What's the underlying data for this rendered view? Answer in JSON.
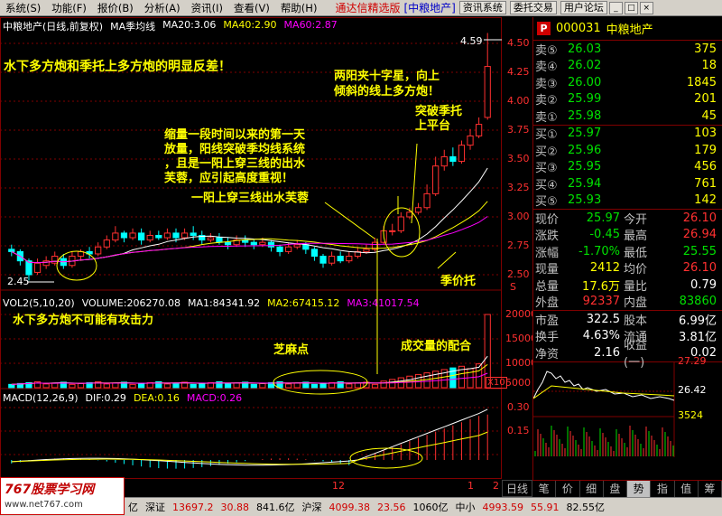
{
  "menu": {
    "items": [
      "系统(S)",
      "功能(F)",
      "报价(B)",
      "分析(A)",
      "资讯(I)",
      "查看(V)",
      "帮助(H)"
    ],
    "brand": "通达信精选版",
    "stock_tag": "[中粮地产]",
    "buttons": [
      "资讯系统",
      "委托交易",
      "用户论坛"
    ],
    "win_buttons": [
      "_",
      "□",
      "×"
    ]
  },
  "kline": {
    "title": "中粮地产(日线,前复权)",
    "indicator": "MA季均线",
    "ma20": "MA20:3.06",
    "ma40": "MA40:2.90",
    "ma60": "MA60:2.87",
    "high_label": "4.59",
    "low_label": "2.45",
    "y_ticks": [
      "4.50",
      "4.25",
      "4.00",
      "3.75",
      "3.50",
      "3.25",
      "3.00",
      "2.75",
      "2.50"
    ],
    "s_mark": "S"
  },
  "volume": {
    "title": "VOL2(5,10,20)",
    "vol": "VOLUME:206270.08",
    "ma1": "MA1:84341.92",
    "ma2": "MA2:67415.12",
    "ma3": "MA3:41017.54",
    "y_ticks": [
      "20000",
      "15000",
      "10000",
      "5000"
    ],
    "unit": "X10"
  },
  "macd": {
    "title": "MACD(12,26,9)",
    "dif": "DIF:0.29",
    "dea": "DEA:0.16",
    "macd": "MACD:0.26",
    "y_ticks": [
      "0.30",
      "0.15"
    ]
  },
  "x_labels": [
    "12",
    "1",
    "2"
  ],
  "annotations": {
    "a1": "水下多方炮和季托上多方炮的明显反差！",
    "a2_line1": "两阳夹十字星，向上",
    "a2_line2": "倾斜的线上多方炮！",
    "a3_line1": "突破季托",
    "a3_line2": "上平台",
    "a4_line1": "缩量一段时间以来的第一天",
    "a4_line2": "放量，阳线突破季均线系统",
    "a4_line3": "，且是一阳上穿三线的出水",
    "a4_line4": "芙蓉，应引起高度重视！",
    "a5": "一阳上穿三线出水芙蓉",
    "a6": "季价托",
    "a7": "水下多方炮不可能有攻击力",
    "a8": "芝麻点",
    "a9": "成交量的配合"
  },
  "quote": {
    "p": "P",
    "code": "000031",
    "name": "中粮地产",
    "sells": [
      {
        "label": "卖⑤",
        "price": "26.03",
        "vol": "375"
      },
      {
        "label": "卖④",
        "price": "26.02",
        "vol": "18"
      },
      {
        "label": "卖③",
        "price": "26.00",
        "vol": "1845"
      },
      {
        "label": "卖②",
        "price": "25.99",
        "vol": "201"
      },
      {
        "label": "卖①",
        "price": "25.98",
        "vol": "45"
      }
    ],
    "buys": [
      {
        "label": "买①",
        "price": "25.97",
        "vol": "103"
      },
      {
        "label": "买②",
        "price": "25.96",
        "vol": "179"
      },
      {
        "label": "买③",
        "price": "25.95",
        "vol": "456"
      },
      {
        "label": "买④",
        "price": "25.94",
        "vol": "761"
      },
      {
        "label": "买⑤",
        "price": "25.93",
        "vol": "142"
      }
    ],
    "stats": [
      {
        "l": "现价",
        "v": "25.97",
        "l2": "今开",
        "v2": "26.10"
      },
      {
        "l": "涨跌",
        "v": "-0.45",
        "l2": "最高",
        "v2": "26.94"
      },
      {
        "l": "涨幅",
        "v": "-1.70%",
        "l2": "最低",
        "v2": "25.55"
      },
      {
        "l": "现量",
        "v": "2412",
        "l2": "均价",
        "v2": "26.10"
      },
      {
        "l": "总量",
        "v": "17.6万",
        "l2": "量比",
        "v2": "0.79"
      },
      {
        "l": "外盘",
        "v": "92337",
        "l2": "内盘",
        "v2": "83860"
      }
    ],
    "stats2": [
      {
        "l": "市盈",
        "v": "322.5",
        "l2": "股本",
        "v2": "6.99亿"
      },
      {
        "l": "换手",
        "v": "4.63%",
        "l2": "流通",
        "v2": "3.81亿"
      },
      {
        "l": "净资",
        "v": "2.16",
        "l2": "收益(一)",
        "v2": "0.02"
      }
    ],
    "mini_ticks": [
      "27.29",
      "26.42",
      "3524"
    ]
  },
  "bottom_tabs": [
    "笔",
    "价",
    "细",
    "盘",
    "势",
    "指",
    "值",
    "筹"
  ],
  "left_tab": "日线",
  "status": {
    "prefix": "亿",
    "sz_label": "深证",
    "sz_val": "13697.2",
    "sz_chg": "30.88",
    "sz_amt": "841.6亿",
    "hs_label": "沪深",
    "hs_val": "4099.38",
    "hs_chg": "23.56",
    "hs_amt": "1060亿",
    "zx_label": "中小",
    "zx_val": "4993.59",
    "zx_chg": "55.91",
    "zx_amt": "82.55亿"
  },
  "watermark": {
    "title": "767股票学习网",
    "url": "www.net767.com"
  },
  "colors": {
    "up": "#ff3030",
    "down": "#00ffff",
    "ma20": "#ffffff",
    "ma40": "#ffff00",
    "ma60": "#ff00ff",
    "annotation": "#ffff00"
  }
}
